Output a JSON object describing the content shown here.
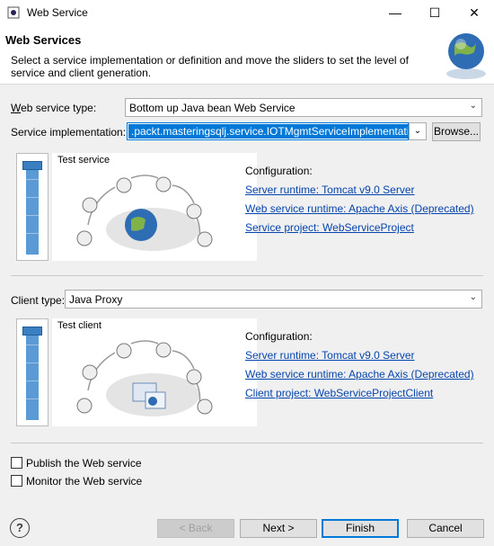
{
  "window": {
    "title": "Web Service",
    "minimize": "—",
    "maximize": "☐",
    "close": "✕"
  },
  "banner": {
    "heading": "Web Services",
    "description": "Select a service implementation or definition and move the sliders to set the level of service and client generation."
  },
  "service": {
    "type_label": "Web service type:",
    "type_value": "Bottom up Java bean Web Service",
    "impl_label": "Service implementation:",
    "impl_value": ".packt.masteringsqlj.service.IOTMgmtServiceImplementation",
    "browse_label": "Browse...",
    "slider_caption": "Test service",
    "config_heading": "Configuration:",
    "links": [
      "Server runtime: Tomcat v9.0 Server",
      "Web service runtime: Apache Axis (Deprecated)",
      "Service project: WebServiceProject"
    ]
  },
  "client": {
    "type_label": "Client type:",
    "type_value": "Java Proxy",
    "slider_caption": "Test client",
    "config_heading": "Configuration:",
    "links": [
      "Server runtime: Tomcat v9.0 Server",
      "Web service runtime: Apache Axis (Deprecated)",
      "Client project: WebServiceProjectClient"
    ]
  },
  "options": {
    "publish_label": "Publish the Web service",
    "monitor_label": "Monitor the Web service"
  },
  "footer": {
    "help": "?",
    "back": "< Back",
    "next": "Next >",
    "finish": "Finish",
    "cancel": "Cancel"
  }
}
